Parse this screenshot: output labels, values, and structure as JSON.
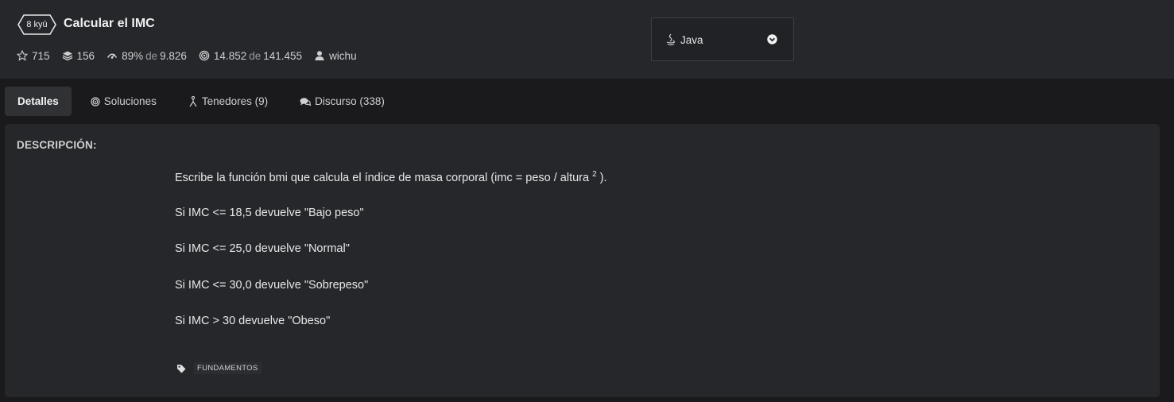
{
  "kata": {
    "rank": "8 kyū",
    "title": "Calcular el IMC"
  },
  "stats": {
    "stars": "715",
    "collections": "156",
    "satisfaction": "89%",
    "satisfaction_of": "de",
    "satisfaction_votes": "9.826",
    "completed": "14.852",
    "completed_of": "de",
    "completed_total": "141.455",
    "author": "wichu"
  },
  "language": {
    "selected": "Java"
  },
  "tabs": [
    {
      "label": "Detalles",
      "icon": "none",
      "active": true
    },
    {
      "label": "Soluciones",
      "icon": "target-icon",
      "active": false
    },
    {
      "label": "Tenedores (9)",
      "icon": "fork-icon",
      "active": false
    },
    {
      "label": "Discurso (338)",
      "icon": "comments-icon",
      "active": false
    }
  ],
  "description": {
    "heading": "DESCRIPCIÓN:",
    "line1_main": "Escribe la función bmi que calcula el índice de masa corporal (imc = peso / altura",
    "line1_sup": "2",
    "line1_end": ").",
    "line2": "Si IMC <= 18,5 devuelve \"Bajo peso\"",
    "line3": "Si IMC <= 25,0 devuelve \"Normal\"",
    "line4": "Si IMC <= 30,0 devuelve \"Sobrepeso\"",
    "line5": "Si IMC > 30 devuelve \"Obeso\"",
    "tag": "FUNDAMENTOS"
  },
  "colors": {
    "background": "#1a1a1d",
    "panel": "#26272b",
    "active_tab": "#303135"
  }
}
